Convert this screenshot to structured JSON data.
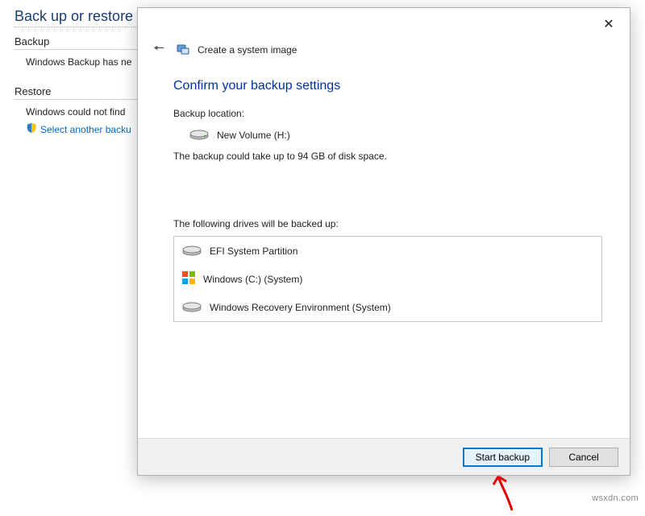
{
  "bg": {
    "title": "Back up or restore your files",
    "backup_hdr": "Backup",
    "backup_text": "Windows Backup has ne",
    "restore_hdr": "Restore",
    "restore_text": "Windows could not find",
    "restore_link": "Select another backu"
  },
  "dialog": {
    "header_title": "Create a system image",
    "heading": "Confirm your backup settings",
    "location_label": "Backup location:",
    "location_value": "New Volume (H:)",
    "estimate": "The backup could take up to 94 GB of disk space.",
    "drives_label": "The following drives will be backed up:",
    "drives": [
      {
        "name": "EFI System Partition",
        "kind": "drive"
      },
      {
        "name": "Windows (C:) (System)",
        "kind": "windows"
      },
      {
        "name": "Windows Recovery Environment (System)",
        "kind": "drive"
      }
    ],
    "start_label": "Start backup",
    "cancel_label": "Cancel"
  },
  "watermark": "wsxdn.com"
}
